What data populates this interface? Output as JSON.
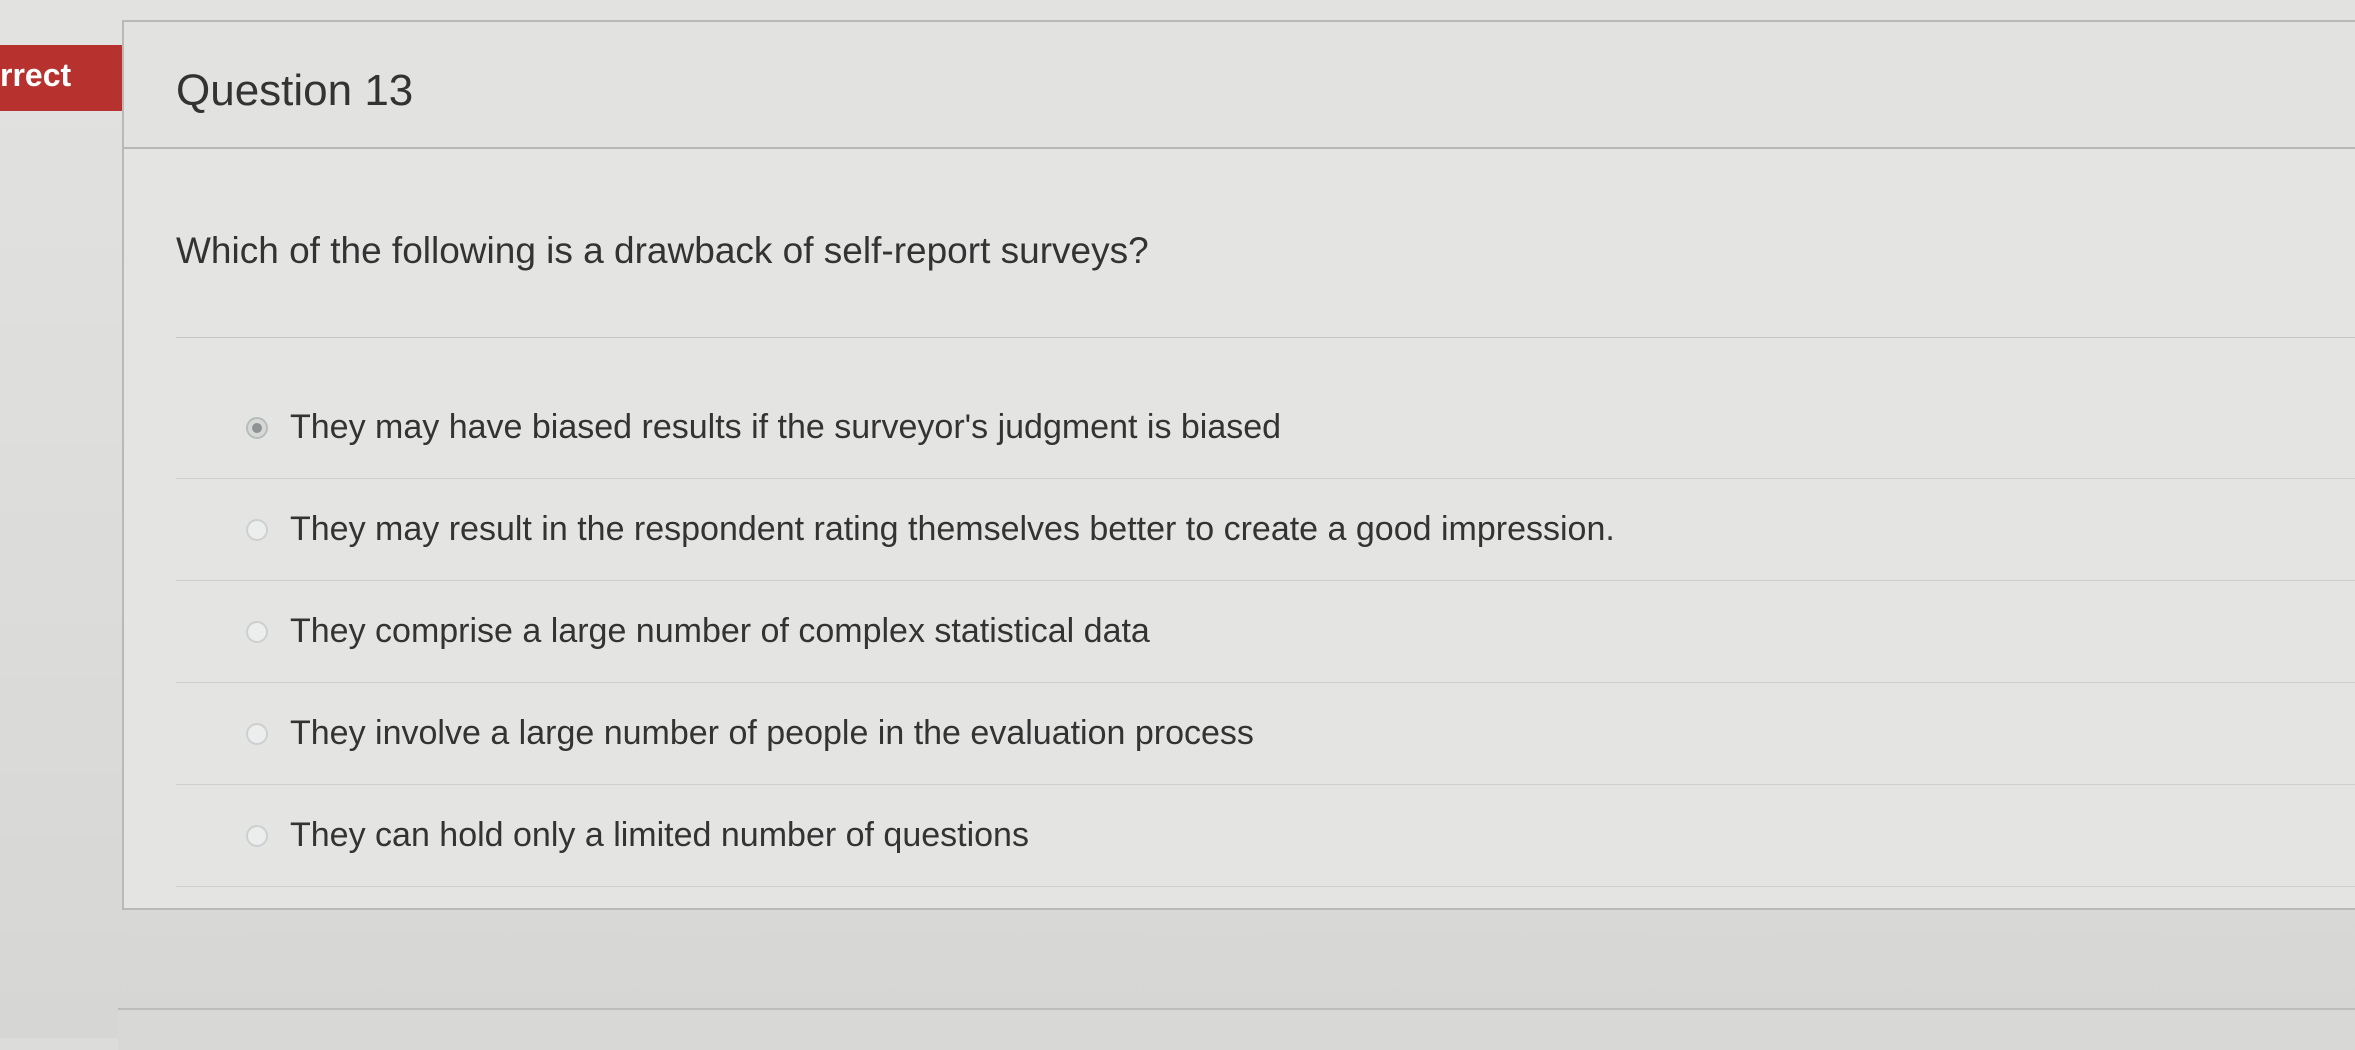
{
  "question": {
    "status": "rrect",
    "title": "Question 13",
    "prompt": "Which of the following is a drawback of self-report surveys?",
    "answers": [
      {
        "label": "They may have biased results if the surveyor's judgment is biased",
        "selected": true
      },
      {
        "label": "They may result in the respondent rating themselves better to create a good impression.",
        "selected": false
      },
      {
        "label": "They comprise a large number of complex statistical data",
        "selected": false
      },
      {
        "label": "They involve a large number of people in the evaluation process",
        "selected": false
      },
      {
        "label": "They can hold only a limited number of questions",
        "selected": false
      }
    ]
  },
  "colors": {
    "status_badge": "#b7322e",
    "text": "#333333",
    "background": "#e2e2e0"
  }
}
